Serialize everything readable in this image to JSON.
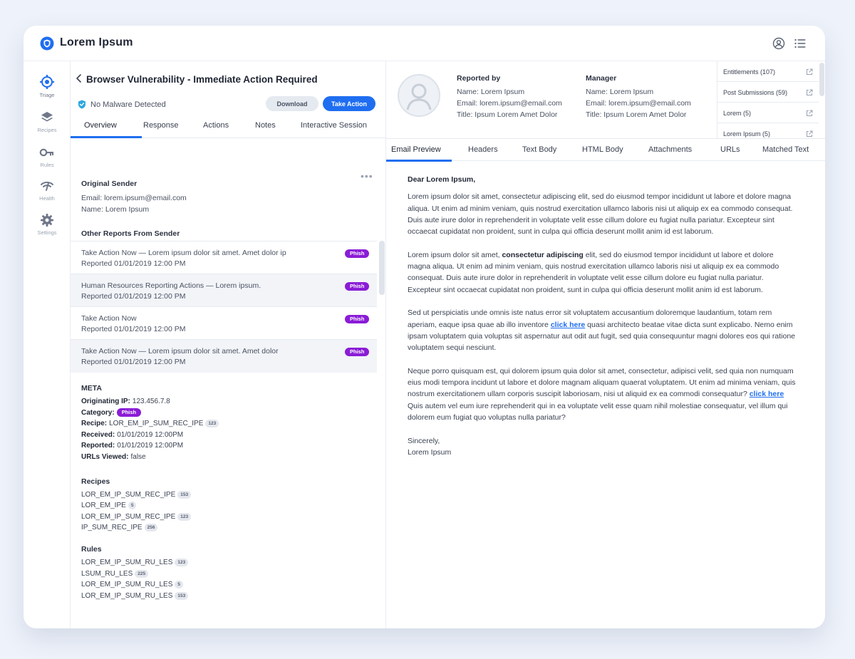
{
  "app": {
    "title": "Lorem Ipsum"
  },
  "rail": [
    {
      "label": "Triage",
      "icon": "crosshair-icon"
    },
    {
      "label": "Recipes",
      "icon": "layers-icon"
    },
    {
      "label": "Rules",
      "icon": "key-icon"
    },
    {
      "label": "Health",
      "icon": "signal-icon"
    },
    {
      "label": "Settings",
      "icon": "gear-icon"
    }
  ],
  "incident": {
    "title": "Browser Vulnerability - Immediate Action Required",
    "status": "No Malware Detected",
    "download_label": "Download",
    "action_label": "Take Action"
  },
  "mid_tabs": [
    "Overview",
    "Response",
    "Actions",
    "Notes",
    "Interactive Session"
  ],
  "original_sender": {
    "heading": "Original Sender",
    "email": "Email: lorem.ipsum@email.com",
    "name": "Name: Lorem Ipsum"
  },
  "other_reports": {
    "heading": "Other Reports From Sender",
    "items": [
      {
        "title": "Take Action Now — Lorem ipsum dolor sit amet. Amet dolor ip",
        "date": "Reported 01/01/2019 12:00 PM",
        "tag": "Phish"
      },
      {
        "title": "Human Resources Reporting Actions —  Lorem ipsum.",
        "date": "Reported 01/01/2019 12:00 PM",
        "tag": "Phish"
      },
      {
        "title": "Take Action Now",
        "date": "Reported 01/01/2019 12:00 PM",
        "tag": "Phish"
      },
      {
        "title": "Take Action Now — Lorem ipsum dolor sit amet. Amet dolor",
        "date": "Reported 01/01/2019 12:00 PM",
        "tag": "Phish"
      }
    ]
  },
  "meta": {
    "heading": "META",
    "ip_label": "Originating IP:",
    "ip_value": "123.456.7.8",
    "category_label": "Category:",
    "category_value": "Phish",
    "recipe_label": "Recipe:",
    "recipe_value": "LOR_EM_IP_SUM_REC_IPE",
    "recipe_count": "123",
    "received_label": "Received:",
    "received_value": "01/01/2019 12:00PM",
    "reported_label": "Reported:",
    "reported_value": "01/01/2019 12:00PM",
    "urls_label": "URLs Viewed:",
    "urls_value": "false"
  },
  "recipes": {
    "heading": "Recipes",
    "items": [
      {
        "name": "LOR_EM_IP_SUM_REC_IPE",
        "count": "153"
      },
      {
        "name": "LOR_EM_IPE",
        "count": "5"
      },
      {
        "name": "LOR_EM_IP_SUM_REC_IPE",
        "count": "123"
      },
      {
        "name": "IP_SUM_REC_IPE",
        "count": "256"
      }
    ]
  },
  "rules": {
    "heading": "Rules",
    "items": [
      {
        "name": "LOR_EM_IP_SUM_RU_LES",
        "count": "123"
      },
      {
        "name": "LSUM_RU_LES",
        "count": "225"
      },
      {
        "name": "LOR_EM_IP_SUM_RU_LES",
        "count": "5"
      },
      {
        "name": "LOR_EM_IP_SUM_RU_LES",
        "count": "153"
      }
    ]
  },
  "reported_by": {
    "label": "Reported by",
    "name": "Name: Lorem Ipsum",
    "email": "Email: lorem.ipsum@email.com",
    "title": "Title: Ipsum Lorem Amet Dolor"
  },
  "manager": {
    "label": "Manager",
    "name": "Name: Lorem Ipsum",
    "email": "Email: lorem.ipsum@email.com",
    "title": "Title: Ipsum Lorem Amet Dolor"
  },
  "entitlements": [
    "Entitlements (107)",
    "Post Submissions (59)",
    "Lorem (5)",
    "Lorem Ipsum (5)"
  ],
  "right_tabs": [
    "Email Preview",
    "Headers",
    "Text Body",
    "HTML Body",
    "Attachments",
    "URLs",
    "Matched Text"
  ],
  "email": {
    "greeting": "Dear Lorem Ipsum,",
    "p1": "Lorem ipsum dolor sit amet, consectetur adipiscing elit, sed do eiusmod tempor incididunt ut labore et dolore magna aliqua. Ut enim ad minim veniam, quis nostrud exercitation ullamco laboris nisi ut aliquip ex ea commodo consequat. Duis aute irure dolor in reprehenderit in voluptate velit esse cillum dolore eu fugiat nulla pariatur. Excepteur sint occaecat cupidatat non proident, sunt in culpa qui officia deserunt mollit anim id est laborum.",
    "p2_a": "Lorem ipsum dolor sit amet, ",
    "p2_bold": "consectetur adipiscing",
    "p2_b": " elit, sed do eiusmod tempor incididunt ut labore et dolore magna aliqua. Ut enim ad minim veniam, quis nostrud exercitation ullamco laboris nisi ut aliquip ex ea commodo consequat. Duis aute irure dolor in reprehenderit in voluptate velit esse cillum dolore eu fugiat nulla pariatur. Excepteur sint occaecat cupidatat non proident, sunt in culpa qui officia deserunt mollit anim id est laborum.",
    "p3_a": "Sed ut perspiciatis unde omnis iste natus error sit voluptatem accusantium doloremque laudantium, totam rem aperiam, eaque ipsa quae ab illo inventore ",
    "p3_link": "click here",
    "p3_b": " quasi architecto beatae vitae dicta sunt explicabo. Nemo enim ipsam voluptatem quia voluptas sit aspernatur aut odit aut fugit, sed quia consequuntur magni dolores eos qui ratione voluptatem sequi nesciunt.",
    "p4_a": "Neque porro quisquam est, qui dolorem ipsum quia dolor sit amet, consectetur, adipisci velit, sed quia non numquam eius modi tempora incidunt ut labore et dolore magnam aliquam quaerat voluptatem. Ut enim ad minima veniam, quis nostrum exercitationem ullam corporis suscipit laboriosam, nisi ut aliquid ex ea commodi consequatur?  ",
    "p4_link": "click here",
    "p4_b": " Quis autem vel eum iure reprehenderit qui in ea voluptate velit esse quam nihil molestiae consequatur, vel illum qui dolorem eum fugiat quo voluptas nulla pariatur?",
    "signoff": "Sincerely,",
    "signature": "Lorem Ipsum"
  }
}
